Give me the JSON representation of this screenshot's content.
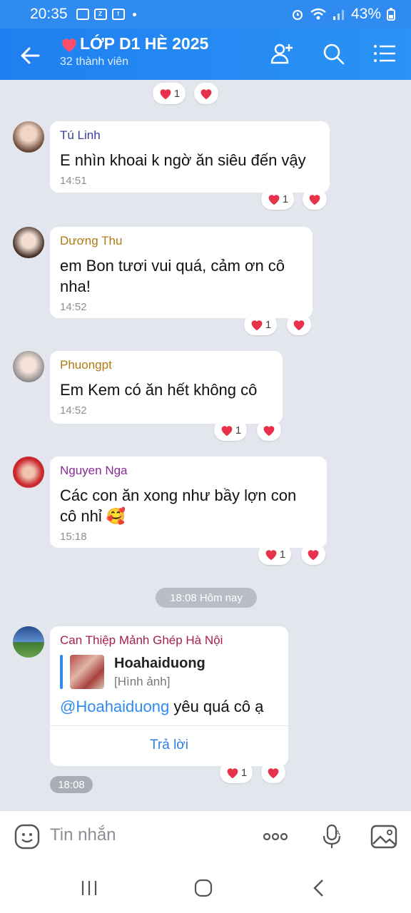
{
  "status_bar": {
    "time": "20:35",
    "battery": "43%"
  },
  "header": {
    "title": "LỚP D1 HÈ 2025",
    "members": "32 thành viên"
  },
  "colors": {
    "accent": "#2f8bf0",
    "heart": "#e8314a"
  },
  "messages": [
    {
      "sender": "Tú Linh",
      "sender_color": "#3a3f9a",
      "text": "E nhìn khoai k ngờ ăn siêu đến vậy",
      "time": "14:51",
      "reaction_count": "1"
    },
    {
      "sender": "Dương Thu",
      "sender_color": "#b07a12",
      "text": "em Bon tươi vui quá, cảm ơn cô nha!",
      "time": "14:52",
      "reaction_count": "1"
    },
    {
      "sender": "Phuongpt",
      "sender_color": "#b07a12",
      "text": "Em Kem có ăn hết không cô",
      "time": "14:52",
      "reaction_count": "1"
    },
    {
      "sender": "Nguyen Nga",
      "sender_color": "#8a2b98",
      "text": "Các con ăn xong như bầy lợn con cô nhỉ 🥰",
      "time": "15:18",
      "reaction_count": "1"
    }
  ],
  "top_reaction_count": "1",
  "date_separator": "18:08 Hôm nay",
  "reply_message": {
    "sender": "Can Thiệp Mảnh Ghép Hà Nội",
    "sender_color": "#a3214a",
    "quoted_name": "Hoahaiduong",
    "quoted_type": "[Hình ảnh]",
    "mention": "@Hoahaiduong",
    "text": " yêu quá cô ạ",
    "reply_button": "Trả lời",
    "time": "18:08",
    "reaction_count": "1"
  },
  "input": {
    "placeholder": "Tin nhắn"
  },
  "icons": [
    "back-arrow-icon",
    "add-member-icon",
    "search-icon",
    "menu-icon",
    "emoji-icon",
    "more-icon",
    "mic-icon",
    "image-icon",
    "heart-icon"
  ]
}
